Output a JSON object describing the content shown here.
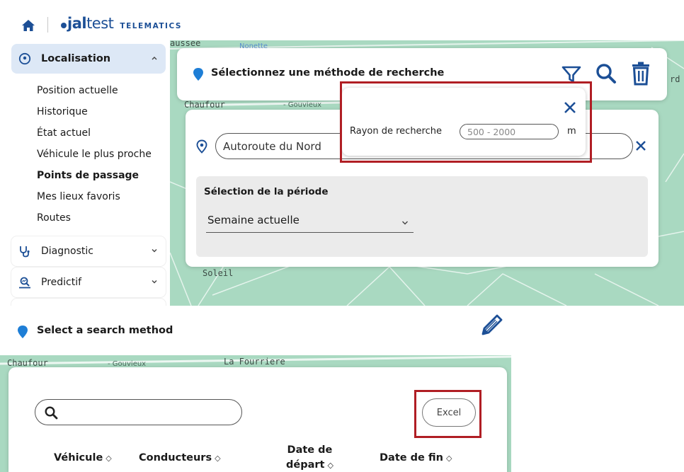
{
  "brand": {
    "logo_jal": "jal",
    "logo_test": "test",
    "logo_suffix": "TELEMATICS",
    "primary_color": "#1c4f96",
    "highlight_color": "#b01e24"
  },
  "sidebar": {
    "active_group": "Localisation",
    "sub_items": [
      "Position actuelle",
      "Historique",
      "État actuel",
      "Véhicule le plus proche",
      "Points de passage",
      "Mes lieux favoris",
      "Routes"
    ],
    "selected_sub_item": "Points de passage",
    "groups": [
      "Diagnostic",
      "Predictif"
    ]
  },
  "map_labels": {
    "top": [
      "aussee",
      "Chaufour",
      "- Gouvieux",
      "Soleil",
      "rd",
      "Nonette"
    ],
    "bottom": [
      "Chaufour",
      "- Gouvieux",
      "La Fourriere"
    ]
  },
  "search_method": {
    "title": "Sélectionnez une méthode de recherche",
    "icons": [
      "filter-icon",
      "search-icon",
      "trash-icon"
    ]
  },
  "location": {
    "value": "Autoroute du Nord"
  },
  "period": {
    "title": "Sélection de la période",
    "selected": "Semaine actuelle"
  },
  "radius_popup": {
    "label": "Rayon de recherche",
    "placeholder": "500 - 2000",
    "unit": "m"
  },
  "bottom": {
    "title": "Select a search method",
    "excel_label": "Excel",
    "columns": [
      {
        "line1": "Véhicule",
        "line2": ""
      },
      {
        "line1": "Conducteurs",
        "line2": ""
      },
      {
        "line1": "Date de",
        "line2": "départ"
      },
      {
        "line1": "Date de fin",
        "line2": ""
      }
    ],
    "sort_glyph": "◇"
  }
}
